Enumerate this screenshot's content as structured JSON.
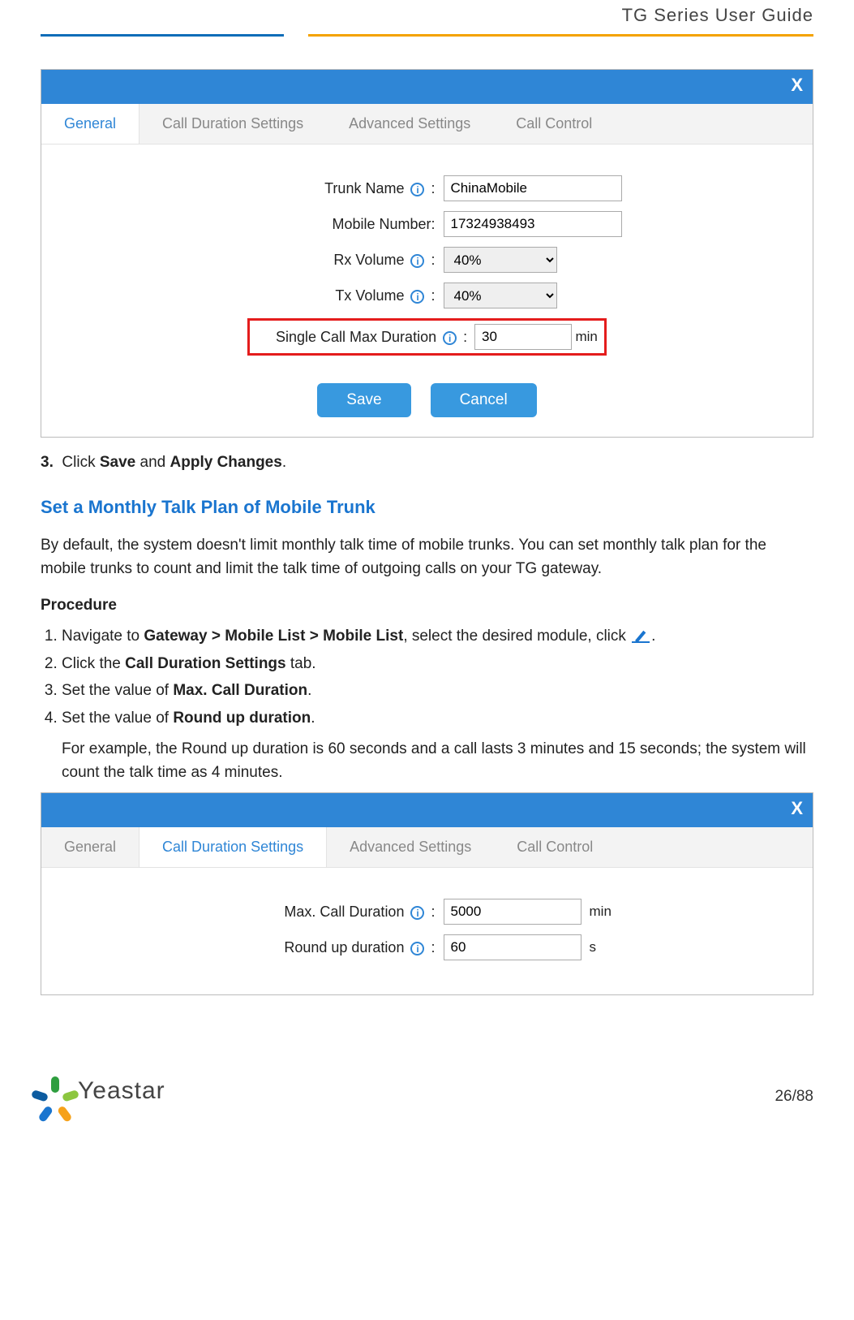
{
  "header": {
    "doc_title": "TG Series User Guide"
  },
  "panel1": {
    "close": "X",
    "tabs": {
      "general": "General",
      "call_duration": "Call Duration Settings",
      "advanced": "Advanced Settings",
      "call_control": "Call Control"
    },
    "fields": {
      "trunk_name_label": "Trunk Name",
      "trunk_name_value": "ChinaMobile",
      "mobile_number_label": "Mobile Number:",
      "mobile_number_value": "17324938493",
      "rx_label": "Rx Volume",
      "rx_value": "40%",
      "tx_label": "Tx Volume",
      "tx_value": "40%",
      "single_max_label": "Single Call Max Duration",
      "single_max_value": "30",
      "single_max_unit": "min"
    },
    "buttons": {
      "save": "Save",
      "cancel": "Cancel"
    }
  },
  "step3": {
    "num": "3.",
    "t1": "Click ",
    "b1": "Save",
    "t2": " and ",
    "b2": "Apply Changes",
    "t3": "."
  },
  "section": {
    "heading": "Set a Monthly Talk Plan of Mobile Trunk",
    "intro": "By default, the system doesn't limit monthly talk time of mobile trunks. You can set monthly talk plan for the mobile trunks to count and limit the talk time of outgoing calls on your TG gateway.",
    "proc_label": "Procedure",
    "s1": {
      "t1": "Navigate to ",
      "b1": "Gateway > Mobile List > Mobile List",
      "t2": ", select the desired module, click ",
      "t3": "."
    },
    "s2": {
      "t1": "Click the ",
      "b1": "Call Duration Settings",
      "t2": " tab."
    },
    "s3": {
      "t1": "Set the value of ",
      "b1": "Max. Call Duration",
      "t2": "."
    },
    "s4": {
      "t1": "Set the value of ",
      "b1": "Round up duration",
      "t2": "."
    },
    "s4_note": "For example, the Round up duration is 60 seconds and a call lasts 3 minutes and 15 seconds; the system will count the talk time as 4 minutes."
  },
  "panel2": {
    "close": "X",
    "tabs": {
      "general": "General",
      "call_duration": "Call Duration Settings",
      "advanced": "Advanced Settings",
      "call_control": "Call Control"
    },
    "fields": {
      "max_label": "Max. Call Duration",
      "max_value": "5000",
      "max_unit": "min",
      "round_label": "Round up duration",
      "round_value": "60",
      "round_unit": "s"
    }
  },
  "footer": {
    "logo_text": "Yeastar",
    "page": "26/88"
  }
}
